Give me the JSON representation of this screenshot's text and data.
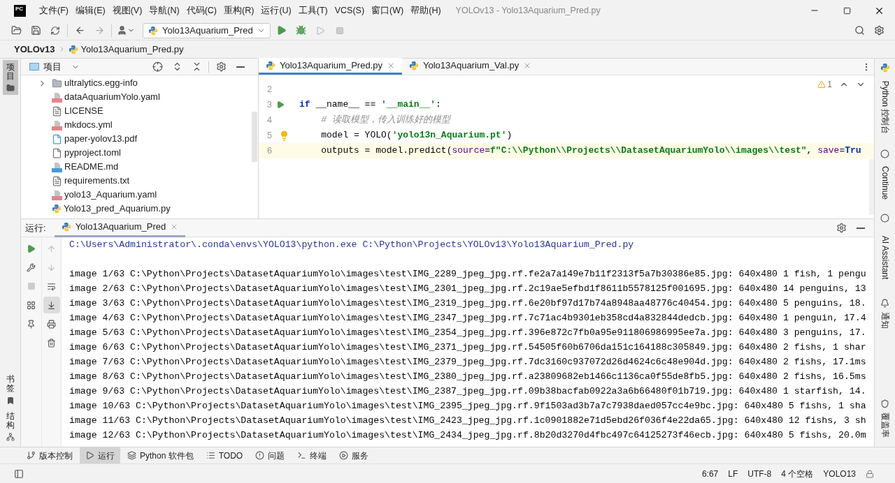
{
  "title_bar": {
    "logo": "PC",
    "menus": [
      "文件(F)",
      "编辑(E)",
      "视图(V)",
      "导航(N)",
      "代码(C)",
      "重构(R)",
      "运行(U)",
      "工具(T)",
      "VCS(S)",
      "窗口(W)",
      "帮助(H)"
    ],
    "title": "YOLOv13 - Yolo13Aquarium_Pred.py"
  },
  "toolbar": {
    "run_config": "Yolo13Aquarium_Pred"
  },
  "breadcrumb": [
    "YOLOv13",
    "Yolo13Aquarium_Pred.py"
  ],
  "left_stripe": {
    "top": [
      {
        "label": "项目",
        "selected": true
      }
    ],
    "bottom": [
      {
        "label": "书签",
        "kind": "bookmark"
      },
      {
        "label": "结构",
        "kind": "structure"
      }
    ]
  },
  "project_panel": {
    "title": "项目",
    "items": [
      {
        "name": "ultralytics.egg-info",
        "kind": "folder"
      },
      {
        "name": "dataAquariumYolo.yaml",
        "kind": "yaml"
      },
      {
        "name": "LICENSE",
        "kind": "text"
      },
      {
        "name": "mkdocs.yml",
        "kind": "yaml"
      },
      {
        "name": "paper-yolov13.pdf",
        "kind": "unknown"
      },
      {
        "name": "pyproject.toml",
        "kind": "toml"
      },
      {
        "name": "README.md",
        "kind": "md"
      },
      {
        "name": "requirements.txt",
        "kind": "text"
      },
      {
        "name": "yolo13_Aquarium.yaml",
        "kind": "yaml"
      },
      {
        "name": "Yolo13_pred_Aquarium.py",
        "kind": "python"
      }
    ]
  },
  "editor": {
    "tabs": [
      {
        "label": "Yolo13Aquarium_Pred.py",
        "selected": true
      },
      {
        "label": "Yolo13Aquarium_Val.py",
        "selected": false
      }
    ],
    "warning_count": "1",
    "lines": [
      {
        "number": "2",
        "current": false,
        "run_marker": false,
        "bulb": false
      },
      {
        "number": "3",
        "current": false,
        "run_marker": true,
        "bulb": false,
        "tokens": [
          {
            "text": "if",
            "kind": "keyword"
          },
          {
            "text": " __name__ == ",
            "kind": "plain"
          },
          {
            "text": "'__main__'",
            "kind": "string"
          },
          {
            "text": ":",
            "kind": "plain"
          }
        ]
      },
      {
        "number": "4",
        "current": false,
        "run_marker": false,
        "bulb": false,
        "tokens": [
          {
            "text": "    # 读取模型，传入训练好的模型",
            "kind": "comment"
          }
        ]
      },
      {
        "number": "5",
        "current": false,
        "run_marker": false,
        "bulb": true,
        "tokens": [
          {
            "text": "    model = YOLO(",
            "kind": "plain"
          },
          {
            "text": "'yolo13n_Aquarium.pt'",
            "kind": "string"
          },
          {
            "text": ")",
            "kind": "plain"
          }
        ]
      },
      {
        "number": "6",
        "current": true,
        "run_marker": false,
        "bulb": false,
        "tokens": [
          {
            "text": "    outputs = model.predict(",
            "kind": "plain"
          },
          {
            "text": "source",
            "kind": "param"
          },
          {
            "text": "=",
            "kind": "plain"
          },
          {
            "text": "f\"C:\\\\Python\\\\Projects\\\\DatasetAquariumYolo\\\\images\\\\test\"",
            "kind": "string"
          },
          {
            "text": ", ",
            "kind": "plain"
          },
          {
            "text": "save",
            "kind": "param"
          },
          {
            "text": "=",
            "kind": "plain"
          },
          {
            "text": "Tru",
            "kind": "keyword"
          }
        ]
      }
    ]
  },
  "run_panel": {
    "label": "运行:",
    "tab": "Yolo13Aquarium_Pred",
    "command": "C:\\Users\\Administrator\\.conda\\envs\\YOLO13\\python.exe C:\\Python\\Projects\\YOLOv13\\Yolo13Aquarium_Pred.py",
    "output": [
      "image 1/63 C:\\Python\\Projects\\DatasetAquariumYolo\\images\\test\\IMG_2289_jpeg_jpg.rf.fe2a7a149e7b11f2313f5a7b30386e85.jpg: 640x480 1 fish, 1 pengu",
      "image 2/63 C:\\Python\\Projects\\DatasetAquariumYolo\\images\\test\\IMG_2301_jpeg_jpg.rf.2c19ae5efbd1f8611b5578125f001695.jpg: 640x480 14 penguins, 13",
      "image 3/63 C:\\Python\\Projects\\DatasetAquariumYolo\\images\\test\\IMG_2319_jpeg_jpg.rf.6e20bf97d17b74a8948aa48776c40454.jpg: 640x480 5 penguins, 18.",
      "image 4/63 C:\\Python\\Projects\\DatasetAquariumYolo\\images\\test\\IMG_2347_jpeg_jpg.rf.7c71ac4b9301eb358cd4a832844dedcb.jpg: 640x480 1 penguin, 17.4",
      "image 5/63 C:\\Python\\Projects\\DatasetAquariumYolo\\images\\test\\IMG_2354_jpeg_jpg.rf.396e872c7fb0a95e911806986995ee7a.jpg: 640x480 3 penguins, 17.",
      "image 6/63 C:\\Python\\Projects\\DatasetAquariumYolo\\images\\test\\IMG_2371_jpeg_jpg.rf.54505f60b6706da151c164188c305849.jpg: 640x480 2 fishs, 1 shar",
      "image 7/63 C:\\Python\\Projects\\DatasetAquariumYolo\\images\\test\\IMG_2379_jpeg_jpg.rf.7dc3160c937072d26d4624c6c48e904d.jpg: 640x480 2 fishs, 17.1ms",
      "image 8/63 C:\\Python\\Projects\\DatasetAquariumYolo\\images\\test\\IMG_2380_jpeg_jpg.rf.a23809682eb1466c1136ca0f55de8fb5.jpg: 640x480 2 fishs, 16.5ms",
      "image 9/63 C:\\Python\\Projects\\DatasetAquariumYolo\\images\\test\\IMG_2387_jpeg_jpg.rf.09b38bacfab0922a3a6b66480f01b719.jpg: 640x480 1 starfish, 14.",
      "image 10/63 C:\\Python\\Projects\\DatasetAquariumYolo\\images\\test\\IMG_2395_jpeg_jpg.rf.9f1503ad3b7a7c7938daed057cc4e9bc.jpg: 640x480 5 fishs, 1 sha",
      "image 11/63 C:\\Python\\Projects\\DatasetAquariumYolo\\images\\test\\IMG_2423_jpeg_jpg.rf.1c0901882e71d5ebd26f036f4e22da65.jpg: 640x480 12 fishs, 3 sh",
      "image 12/63 C:\\Python\\Projects\\DatasetAquariumYolo\\images\\test\\IMG_2434_jpeg_jpg.rf.8b20d3270d4fbc497c64125273f46ecb.jpg: 640x480 5 fishs, 20.0m"
    ]
  },
  "tool_windows": [
    {
      "label": "版本控制",
      "kind": "vcs",
      "selected": false
    },
    {
      "label": "运行",
      "kind": "run",
      "selected": true
    },
    {
      "label": "Python 软件包",
      "kind": "packages",
      "selected": false
    },
    {
      "label": "TODO",
      "kind": "todo",
      "selected": false
    },
    {
      "label": "问题",
      "kind": "problems",
      "selected": false
    },
    {
      "label": "终端",
      "kind": "terminal",
      "selected": false
    },
    {
      "label": "服务",
      "kind": "services",
      "selected": false
    }
  ],
  "right_stripe": [
    {
      "label": "Python 控制台",
      "kind": "python"
    },
    {
      "label": "Continue",
      "kind": "continue"
    },
    {
      "label": "AI Assistant",
      "kind": "ai"
    },
    {
      "label": "通知",
      "kind": "bell"
    },
    {
      "label": "覆盖率",
      "kind": "shield"
    }
  ],
  "status_bar": [
    "6:67",
    "LF",
    "UTF-8",
    "4 个空格",
    "YOLO13"
  ]
}
